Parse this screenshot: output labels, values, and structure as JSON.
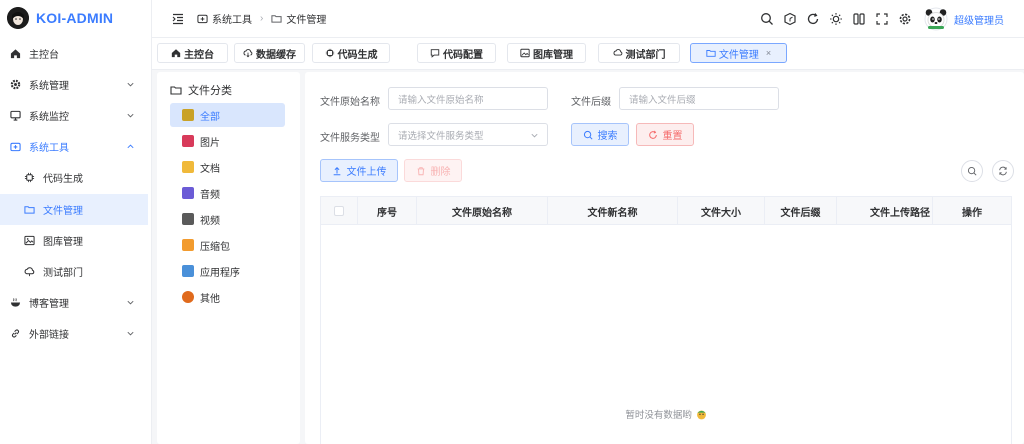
{
  "app": {
    "logo_text": "KOI-ADMIN"
  },
  "sidebar": {
    "items": [
      {
        "label": "主控台",
        "icon": "home-icon"
      },
      {
        "label": "系统管理",
        "icon": "gear-icon",
        "has_children": true
      },
      {
        "label": "系统监控",
        "icon": "monitor-icon",
        "has_children": true
      },
      {
        "label": "系统工具",
        "icon": "toolbox-icon",
        "has_children": true,
        "expanded": true
      },
      {
        "label": "代码生成",
        "icon": "cpu-icon"
      },
      {
        "label": "文件管理",
        "icon": "folder-icon",
        "active": true
      },
      {
        "label": "图库管理",
        "icon": "picture-icon"
      },
      {
        "label": "测试部门",
        "icon": "cloud-icon"
      },
      {
        "label": "博客管理",
        "icon": "bowl-icon",
        "has_children": true
      },
      {
        "label": "外部链接",
        "icon": "link-icon",
        "has_children": true
      }
    ]
  },
  "header": {
    "breadcrumb": [
      "系统工具",
      "文件管理"
    ],
    "username": "超级管理员"
  },
  "tabs": [
    {
      "label": "主控台",
      "icon": "home-icon"
    },
    {
      "label": "数据缓存",
      "icon": "cloud-download-icon"
    },
    {
      "label": "代码生成",
      "icon": "cpu-icon"
    },
    {
      "label": "代码配置",
      "icon": "chat-icon"
    },
    {
      "label": "图库管理",
      "icon": "picture-icon"
    },
    {
      "label": "测试部门",
      "icon": "cloud-icon"
    },
    {
      "label": "文件管理",
      "icon": "folder-icon",
      "active": true,
      "closable": true,
      "close": "×"
    }
  ],
  "categories": {
    "title": "文件分类",
    "items": [
      {
        "label": "全部",
        "active": true,
        "color": "#c9a227"
      },
      {
        "label": "图片",
        "color": "#d83a5a"
      },
      {
        "label": "文档",
        "color": "#f0b93a"
      },
      {
        "label": "音频",
        "color": "#6b5bd6"
      },
      {
        "label": "视频",
        "color": "#5a5a5a"
      },
      {
        "label": "压缩包",
        "color": "#f29b2e"
      },
      {
        "label": "应用程序",
        "color": "#4a90d9"
      },
      {
        "label": "其他",
        "color": "#e06a1c"
      }
    ]
  },
  "search_form": {
    "original_name_label": "文件原始名称",
    "original_name_placeholder": "请输入文件原始名称",
    "suffix_label": "文件后缀",
    "suffix_placeholder": "请输入文件后缀",
    "service_type_label": "文件服务类型",
    "service_type_placeholder": "请选择文件服务类型",
    "search_label": "搜索",
    "reset_label": "重置"
  },
  "toolbar": {
    "upload_label": "文件上传",
    "delete_label": "删除"
  },
  "table": {
    "columns": [
      "序号",
      "文件原始名称",
      "文件新名称",
      "文件大小",
      "文件后缀",
      "文件上传路径",
      "操作"
    ],
    "empty_text": "暂时没有数据哟"
  },
  "colors": {
    "primary": "#3b7cff",
    "danger": "#f56c6c",
    "active_bg": "#e8f0fe"
  }
}
